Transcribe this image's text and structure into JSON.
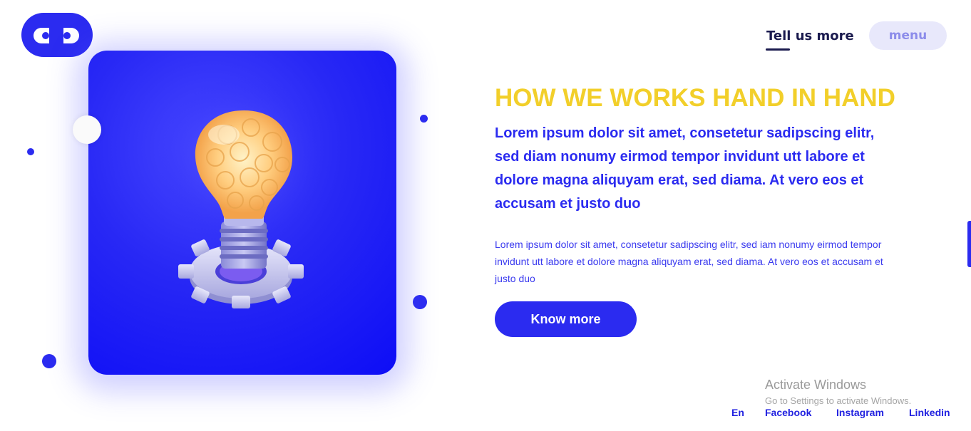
{
  "header": {
    "tell_us_more": "Tell us more",
    "menu_label": "menu"
  },
  "hero": {
    "headline": "HOW WE WORKS HAND IN HAND",
    "lead": "Lorem ipsum dolor sit amet, consetetur sadipscing elitr, sed diam nonumy eirmod tempor invidunt utt labore et dolore magna aliquyam erat, sed diama. At vero eos et accusam et justo duo",
    "body": "Lorem ipsum dolor sit amet, consetetur sadipscing elitr, sed iam nonumy eirmod tempor invidunt utt labore et dolore magna aliquyam erat, sed diama. At vero eos et accusam et justo duo",
    "cta_label": "Know more",
    "illustration_icon": "lightbulb-gear-icon"
  },
  "watermark": {
    "title": "Activate Windows",
    "subtitle": "Go to Settings to activate Windows."
  },
  "footer": {
    "language": "En",
    "facebook": "Facebook",
    "instagram": "Instagram",
    "linkedin": "Linkedin"
  },
  "colors": {
    "brand_blue": "#2b2bf0",
    "headline_yellow": "#f2cf2a",
    "menu_bg": "#e8e8fb",
    "dark_navy": "#1a1a4e"
  }
}
